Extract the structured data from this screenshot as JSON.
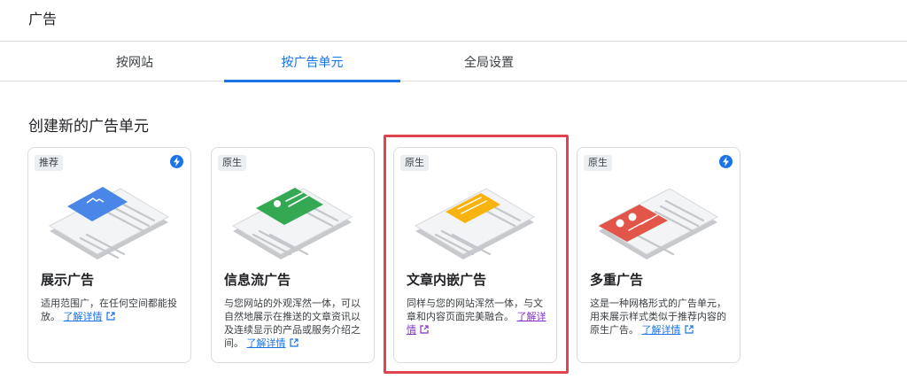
{
  "header": {
    "title": "广告"
  },
  "tabs": [
    {
      "label": "按网站",
      "active": false
    },
    {
      "label": "按广告单元",
      "active": true
    },
    {
      "label": "全局设置",
      "active": false
    }
  ],
  "section": {
    "title": "创建新的广告单元"
  },
  "cards": [
    {
      "badge": "推荐",
      "lightning": true,
      "title": "展示广告",
      "description": "适用范围广，在任何空间都能投放。",
      "link": "了解详情",
      "accent": "#4a86e8",
      "highlighted": false
    },
    {
      "badge": "原生",
      "lightning": false,
      "title": "信息流广告",
      "description": "与您网站的外观浑然一体，可以自然地展示在推送的文章资讯以及连续显示的产品或服务介绍之间。",
      "link": "了解详情",
      "accent": "#34a853",
      "highlighted": false
    },
    {
      "badge": "原生",
      "lightning": false,
      "title": "文章内嵌广告",
      "description": "同样与您的网站浑然一体，与文章和内容页面完美融合。",
      "link": "了解详情",
      "accent": "#f9b30f",
      "highlighted": true
    },
    {
      "badge": "原生",
      "lightning": true,
      "title": "多重广告",
      "description": "这是一种网格形式的广告单元，用来展示样式类似于推荐内容的原生广告。",
      "link": "了解详情",
      "accent": "#e25549",
      "highlighted": false
    }
  ],
  "colors": {
    "primary": "#1a73e8",
    "highlight": "#e0454e",
    "visited_link": "#8430ce"
  },
  "icons": {
    "lightning": "bolt-icon",
    "external": "external-link-icon"
  }
}
